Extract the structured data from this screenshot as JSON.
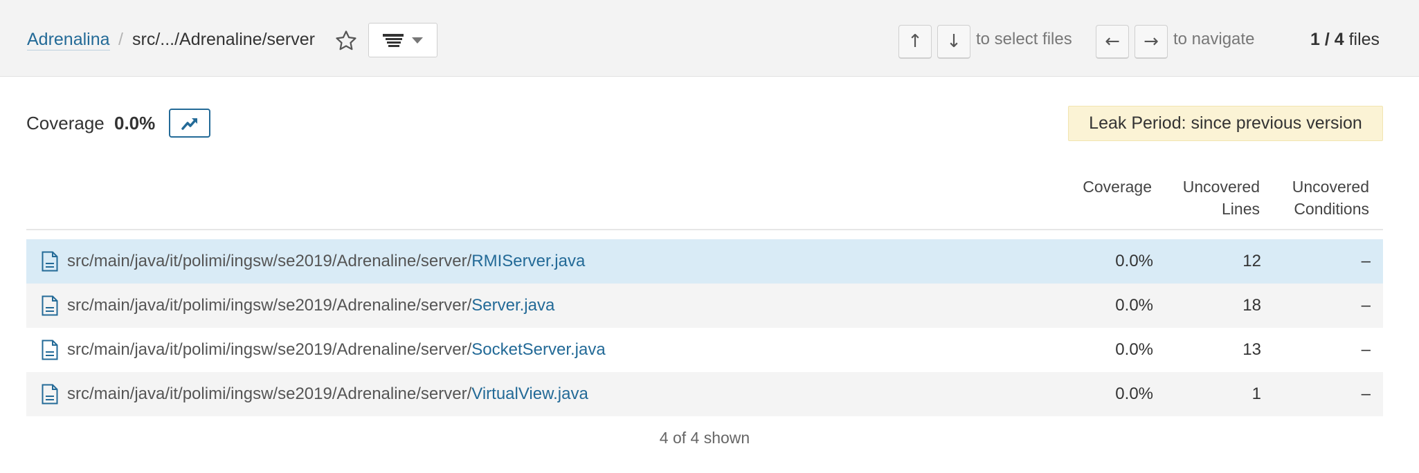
{
  "breadcrumb": {
    "project": "Adrenalina",
    "separator": "/",
    "path": "src/.../Adrenaline/server"
  },
  "nav": {
    "up_key": "↑",
    "down_key": "↓",
    "select_hint": "to select files",
    "left_key": "←",
    "right_key": "→",
    "navigate_hint": "to navigate",
    "files_position": "1 / 4",
    "files_suffix": " files"
  },
  "summary": {
    "metric_label": "Coverage",
    "metric_value": "0.0%",
    "leak_period": "Leak Period: since previous version"
  },
  "table": {
    "columns": {
      "coverage": "Coverage",
      "uncovered_lines_1": "Uncovered",
      "uncovered_lines_2": "Lines",
      "uncovered_conditions_1": "Uncovered",
      "uncovered_conditions_2": "Conditions"
    },
    "rows": [
      {
        "dir": "src/main/java/it/polimi/ingsw/se2019/Adrenaline/server/",
        "name": "RMIServer.java",
        "coverage": "0.0%",
        "uncovered_lines": "12",
        "uncovered_conditions": "–"
      },
      {
        "dir": "src/main/java/it/polimi/ingsw/se2019/Adrenaline/server/",
        "name": "Server.java",
        "coverage": "0.0%",
        "uncovered_lines": "18",
        "uncovered_conditions": "–"
      },
      {
        "dir": "src/main/java/it/polimi/ingsw/se2019/Adrenaline/server/",
        "name": "SocketServer.java",
        "coverage": "0.0%",
        "uncovered_lines": "13",
        "uncovered_conditions": "–"
      },
      {
        "dir": "src/main/java/it/polimi/ingsw/se2019/Adrenaline/server/",
        "name": "VirtualView.java",
        "coverage": "0.0%",
        "uncovered_lines": "1",
        "uncovered_conditions": "–"
      }
    ],
    "shown": "4 of 4 shown"
  },
  "colors": {
    "link": "#236a97",
    "selected_row": "#d9ebf6",
    "leak_background": "#fbf3d5"
  },
  "icons": {
    "favorite": "star-icon",
    "filter": "list-filter-icon",
    "history": "trend-chart-icon",
    "file": "file-icon"
  }
}
